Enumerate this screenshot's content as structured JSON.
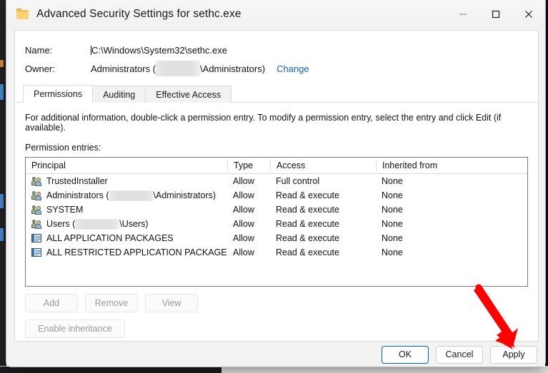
{
  "window": {
    "title": "Advanced Security Settings for sethc.exe",
    "icon": "folder-icon",
    "controls": {
      "minimize": "minimize-icon",
      "maximize": "maximize-icon",
      "close": "close-icon"
    }
  },
  "header": {
    "name_label": "Name:",
    "name_value": "C:\\Windows\\System32\\sethc.exe",
    "owner_label": "Owner:",
    "owner_value_prefix": "Administrators (",
    "owner_value_suffix": "\\Administrators)",
    "owner_change_link": "Change"
  },
  "tabs": [
    {
      "label": "Permissions",
      "selected": true
    },
    {
      "label": "Auditing",
      "selected": false
    },
    {
      "label": "Effective Access",
      "selected": false
    }
  ],
  "panel": {
    "info_text": "For additional information, double-click a permission entry. To modify a permission entry, select the entry and click Edit (if available).",
    "entries_label": "Permission entries:"
  },
  "list": {
    "columns": [
      "Principal",
      "Type",
      "Access",
      "Inherited from"
    ],
    "rows": [
      {
        "icon": "users-group-icon",
        "principal": "TrustedInstaller",
        "principal_suffix": "",
        "redacted": false,
        "type": "Allow",
        "access": "Full control",
        "inherited_from": "None"
      },
      {
        "icon": "users-group-icon",
        "principal": "Administrators (",
        "principal_suffix": "\\Administrators)",
        "redacted": true,
        "type": "Allow",
        "access": "Read & execute",
        "inherited_from": "None"
      },
      {
        "icon": "users-group-icon",
        "principal": "SYSTEM",
        "principal_suffix": "",
        "redacted": false,
        "type": "Allow",
        "access": "Read & execute",
        "inherited_from": "None"
      },
      {
        "icon": "users-group-icon",
        "principal": "Users (",
        "principal_suffix": "\\Users)",
        "redacted": true,
        "type": "Allow",
        "access": "Read & execute",
        "inherited_from": "None"
      },
      {
        "icon": "app-package-icon",
        "principal": "ALL APPLICATION PACKAGES",
        "principal_suffix": "",
        "redacted": false,
        "type": "Allow",
        "access": "Read & execute",
        "inherited_from": "None"
      },
      {
        "icon": "app-package-icon",
        "principal": "ALL RESTRICTED APPLICATION PACKAGES",
        "principal_suffix": "",
        "redacted": false,
        "type": "Allow",
        "access": "Read & execute",
        "inherited_from": "None"
      }
    ]
  },
  "actions": {
    "add": "Add",
    "remove": "Remove",
    "view": "View",
    "enable_inheritance": "Enable inheritance"
  },
  "footer": {
    "ok": "OK",
    "cancel": "Cancel",
    "apply": "Apply"
  },
  "annotation": {
    "type": "arrow",
    "color": "#FF0000",
    "points_to": "apply-button"
  },
  "colors": {
    "accent": "#0b63c5",
    "link": "#0b63c5",
    "annotation": "#FF0000",
    "window_chrome": "#f3f3f3",
    "panel": "#ffffff"
  }
}
